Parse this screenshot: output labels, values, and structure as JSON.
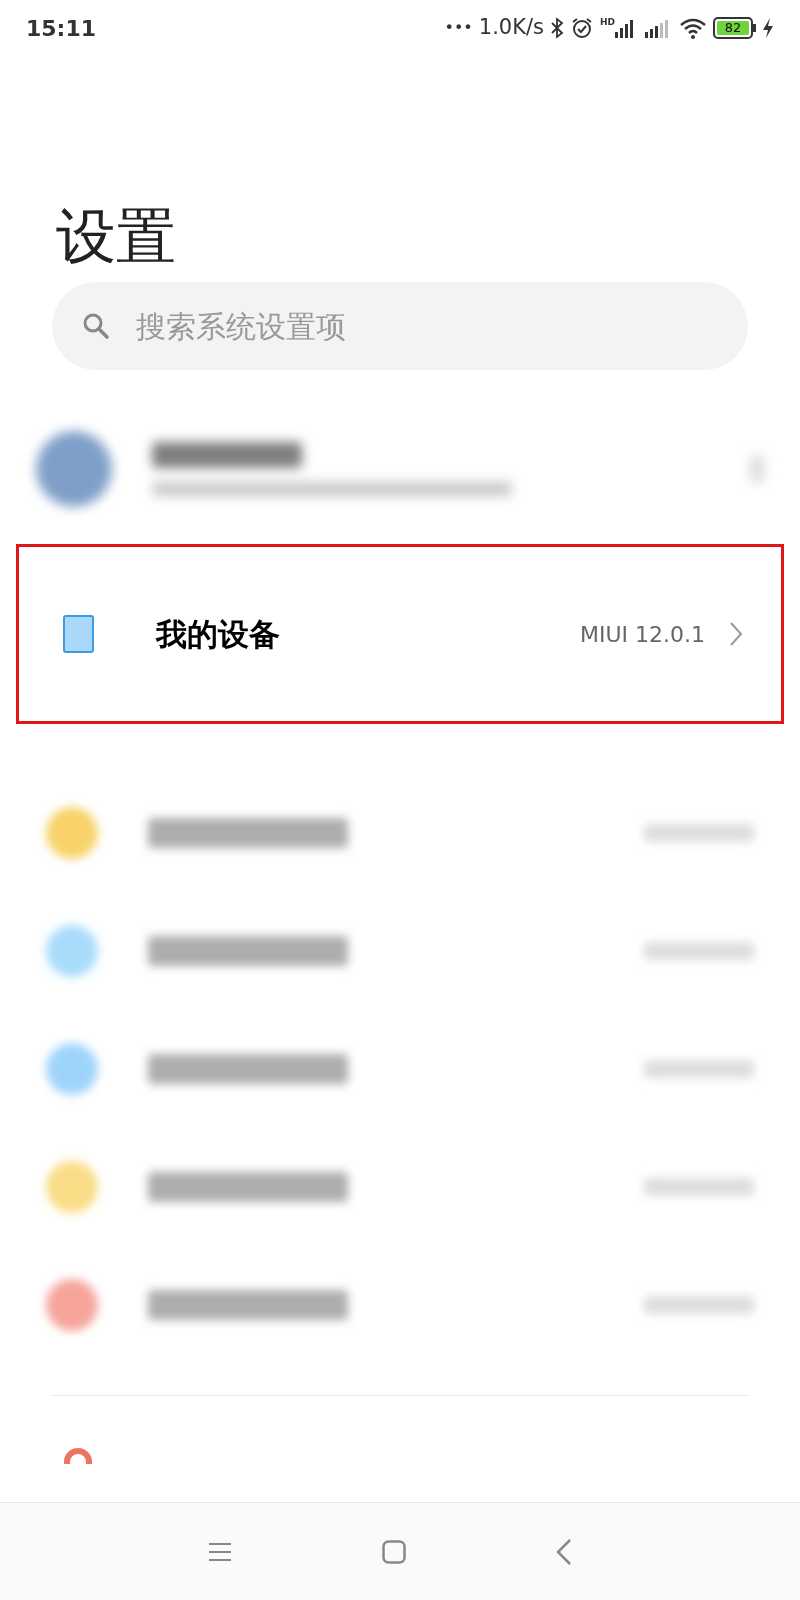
{
  "status_bar": {
    "time": "15:11",
    "dots": "•••",
    "network_speed": "1.0K/s",
    "signal_label": "HD",
    "battery": "82",
    "charging": true
  },
  "title": "设置",
  "search": {
    "placeholder": "搜索系统设置项"
  },
  "rows": [
    {
      "kind": "account",
      "color": "#7f9fc8"
    },
    {
      "kind": "item",
      "label": "我的设备",
      "value": "MIUI 12.0.1",
      "highlighted": true
    },
    {
      "kind": "gap"
    },
    {
      "kind": "blurred",
      "color": "#f8d36a"
    },
    {
      "kind": "blurred",
      "color": "#a9dcfb"
    },
    {
      "kind": "blurred",
      "color": "#9fd4fa"
    },
    {
      "kind": "blurred",
      "color": "#fbdc86"
    },
    {
      "kind": "blurred",
      "color": "#f6a49a"
    },
    {
      "kind": "divider"
    },
    {
      "kind": "partial",
      "color": "#ec7462"
    }
  ]
}
